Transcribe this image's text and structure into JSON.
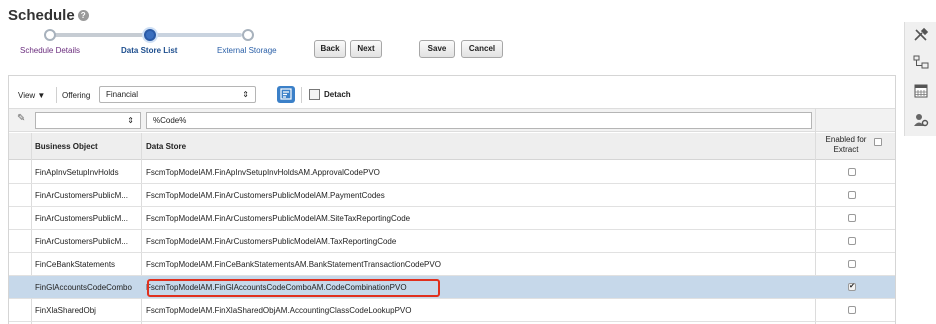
{
  "page": {
    "title": "Schedule"
  },
  "train": {
    "steps": [
      {
        "label": "Schedule Details",
        "state": "visited"
      },
      {
        "label": "Data Store List",
        "state": "current"
      },
      {
        "label": "External Storage",
        "state": "future"
      }
    ]
  },
  "buttons": {
    "back": "Back",
    "next": "Next",
    "save": "Save",
    "cancel": "Cancel"
  },
  "toolbar": {
    "view": "View ▼",
    "offering_label": "Offering",
    "offering_value": "Financial",
    "detach": "Detach"
  },
  "filter": {
    "data_store_value": "%Code%"
  },
  "table": {
    "headers": {
      "business_object": "Business Object",
      "data_store": "Data Store",
      "enabled": "Enabled for Extract"
    },
    "rows": [
      {
        "business_object": "FinApInvSetupInvHolds",
        "data_store": "FscmTopModelAM.FinApInvSetupInvHoldsAM.ApprovalCodePVO",
        "checked": false,
        "selected": false
      },
      {
        "business_object": "FinArCustomersPublicM...",
        "data_store": "FscmTopModelAM.FinArCustomersPublicModelAM.PaymentCodes",
        "checked": false,
        "selected": false
      },
      {
        "business_object": "FinArCustomersPublicM...",
        "data_store": "FscmTopModelAM.FinArCustomersPublicModelAM.SiteTaxReportingCode",
        "checked": false,
        "selected": false
      },
      {
        "business_object": "FinArCustomersPublicM...",
        "data_store": "FscmTopModelAM.FinArCustomersPublicModelAM.TaxReportingCode",
        "checked": false,
        "selected": false
      },
      {
        "business_object": "FinCeBankStatements",
        "data_store": "FscmTopModelAM.FinCeBankStatementsAM.BankStatementTransactionCodePVO",
        "checked": false,
        "selected": false
      },
      {
        "business_object": "FinGlAccountsCodeCombo",
        "data_store": "FscmTopModelAM.FinGlAccountsCodeComboAM.CodeCombinationPVO",
        "checked": true,
        "selected": true
      },
      {
        "business_object": "FinXlaSharedObj",
        "data_store": "FscmTopModelAM.FinXlaSharedObjAM.AccountingClassCodeLookupPVO",
        "checked": false,
        "selected": false
      }
    ]
  },
  "side_icons": [
    "tools-icon",
    "hierarchy-icon",
    "calendar-icon",
    "user-settings-icon"
  ],
  "colors": {
    "selected_row": "#c6d8ea",
    "highlight_border": "#e0301e",
    "accent_blue": "#3b80c8"
  }
}
